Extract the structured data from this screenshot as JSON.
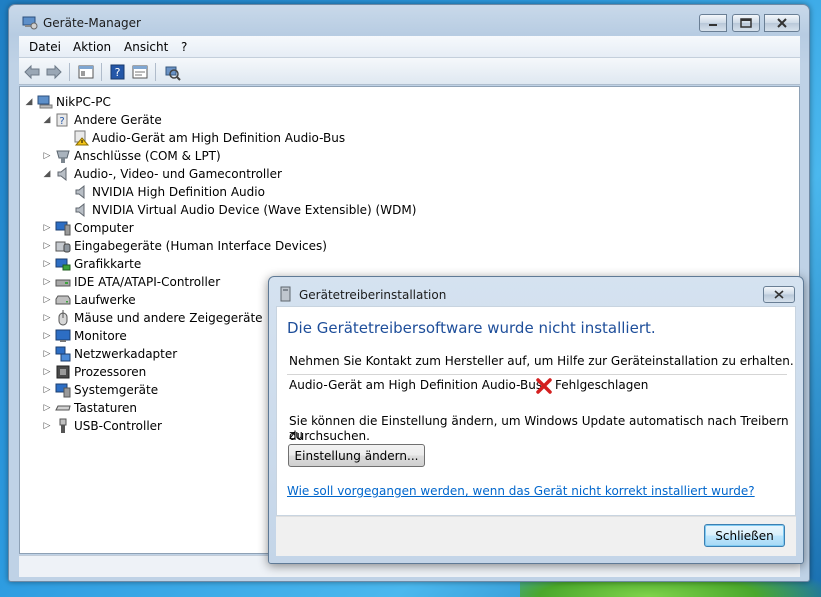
{
  "window": {
    "title": "Geräte-Manager",
    "menu": [
      "Datei",
      "Aktion",
      "Ansicht",
      "?"
    ]
  },
  "tree": {
    "root": "NikPC-PC",
    "items": [
      {
        "label": "Andere Geräte",
        "level": 1,
        "expanded": true,
        "icon": "unknown-device-icon"
      },
      {
        "label": "Audio-Gerät am High Definition Audio-Bus",
        "level": 2,
        "icon": "warning-device-icon"
      },
      {
        "label": "Anschlüsse (COM & LPT)",
        "level": 1,
        "expanded": false,
        "icon": "port-icon"
      },
      {
        "label": "Audio-, Video- und Gamecontroller",
        "level": 1,
        "expanded": true,
        "icon": "speaker-icon"
      },
      {
        "label": "NVIDIA High Definition Audio",
        "level": 2,
        "icon": "speaker-icon"
      },
      {
        "label": "NVIDIA Virtual Audio Device (Wave Extensible) (WDM)",
        "level": 2,
        "icon": "speaker-icon"
      },
      {
        "label": "Computer",
        "level": 1,
        "expanded": false,
        "icon": "computer-icon"
      },
      {
        "label": "Eingabegeräte (Human Interface Devices)",
        "level": 1,
        "expanded": false,
        "icon": "hid-icon"
      },
      {
        "label": "Grafikkarte",
        "level": 1,
        "expanded": false,
        "icon": "display-adapter-icon"
      },
      {
        "label": "IDE ATA/ATAPI-Controller",
        "level": 1,
        "expanded": false,
        "icon": "ide-icon"
      },
      {
        "label": "Laufwerke",
        "level": 1,
        "expanded": false,
        "icon": "drive-icon"
      },
      {
        "label": "Mäuse und andere Zeigegeräte",
        "level": 1,
        "expanded": false,
        "icon": "mouse-icon"
      },
      {
        "label": "Monitore",
        "level": 1,
        "expanded": false,
        "icon": "monitor-icon"
      },
      {
        "label": "Netzwerkadapter",
        "level": 1,
        "expanded": false,
        "icon": "network-icon"
      },
      {
        "label": "Prozessoren",
        "level": 1,
        "expanded": false,
        "icon": "processor-icon"
      },
      {
        "label": "Systemgeräte",
        "level": 1,
        "expanded": false,
        "icon": "system-icon"
      },
      {
        "label": "Tastaturen",
        "level": 1,
        "expanded": false,
        "icon": "keyboard-icon"
      },
      {
        "label": "USB-Controller",
        "level": 1,
        "expanded": false,
        "icon": "usb-icon"
      }
    ]
  },
  "dialog": {
    "title": "Gerätetreiberinstallation",
    "heading": "Die Gerätetreibersoftware wurde nicht installiert.",
    "contact_text": "Nehmen Sie Kontakt zum Hersteller auf, um Hilfe zur Geräteinstallation zu erhalten.",
    "device_name": "Audio-Gerät am High Definition Audio-Bus",
    "device_status": "Fehlgeschlagen",
    "update_text_1": "Sie können die Einstellung ändern, um Windows Update automatisch nach Treibern zu",
    "update_text_2": "durchsuchen.",
    "change_button": "Einstellung ändern...",
    "help_link": "Wie soll vorgegangen werden, wenn das Gerät nicht korrekt installiert wurde?",
    "close_button": "Schließen"
  },
  "colors": {
    "heading": "#1e4e9a",
    "link": "#0066cc",
    "error": "#d42020"
  }
}
